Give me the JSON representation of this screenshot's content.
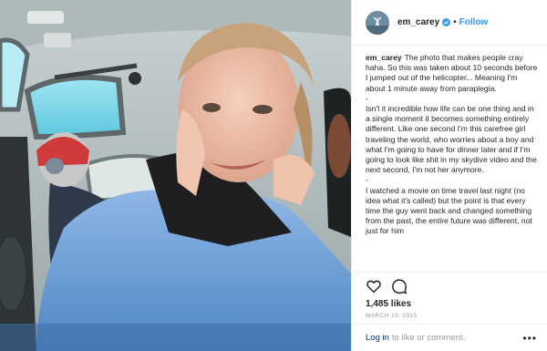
{
  "post": {
    "username": "em_carey",
    "separator": "•",
    "follow_label": "Follow",
    "caption": {
      "username": "em_carey",
      "paragraphs": [
        "The photo that makes people cray haha. So this was taken about 10 seconds before I jumped out of the helicopter... Meaning I'm about 1 minute away from paraplegia.",
        "-",
        "Isn't it incredible how life can be one thing and in a single moment it becomes something entirely different. Like one second I'm this carefree girl traveling the world, who worries about a boy and what I'm going to have for dinner later and if I'm going to look like shit in my skydive video and the next second, I'm not her anymore.",
        "-",
        "I watched a movie on time travel last night (no idea what it's called) but the point is that every time the guy went back and changed something from the past, the entire future was different, not just for him"
      ]
    },
    "likes": "1,485 likes",
    "date": "MARCH 10, 2015",
    "footer": {
      "login_label": "Log in",
      "login_rest": "to like or comment.",
      "more_label": "•••"
    },
    "colors": {
      "link_blue": "#3897f0",
      "verified_blue": "#3897f0",
      "muted_gray": "#999999",
      "border": "#efefef"
    },
    "icons": {
      "like": "heart-icon",
      "comment": "comment-icon",
      "verified": "verified-badge-icon",
      "more": "more-options-icon"
    }
  }
}
